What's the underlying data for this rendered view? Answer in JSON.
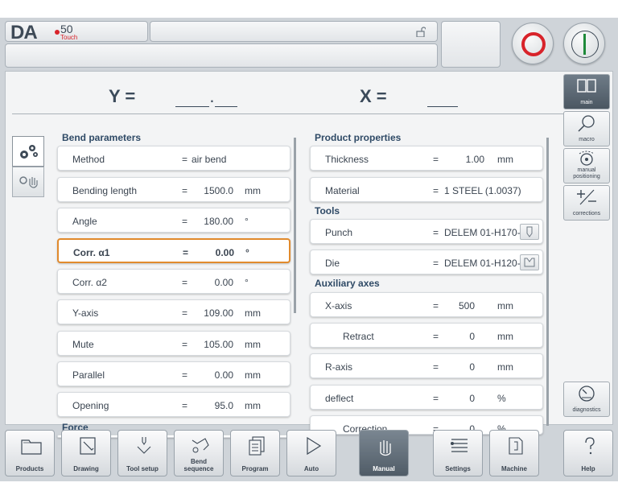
{
  "header": {
    "logo_text": "DA",
    "logo_model": "50",
    "logo_sub": "Touch"
  },
  "position": {
    "y_label": "Y =",
    "y_value": "____.___",
    "x_label": "X =",
    "x_value": "_____"
  },
  "left_panel": {
    "section1": "Bend parameters",
    "rows": [
      {
        "label": "Method",
        "eq": "=",
        "value": "air bend",
        "unit": ""
      },
      {
        "label": "Bending length",
        "eq": "=",
        "value": "1500.0",
        "unit": "mm"
      },
      {
        "label": "Angle",
        "eq": "=",
        "value": "180.00",
        "unit": "°"
      },
      {
        "label": "Corr. α1",
        "eq": "=",
        "value": "0.00",
        "unit": "°"
      },
      {
        "label": "Corr. α2",
        "eq": "=",
        "value": "0.00",
        "unit": "°"
      },
      {
        "label": "Y-axis",
        "eq": "=",
        "value": "109.00",
        "unit": "mm"
      },
      {
        "label": "Mute",
        "eq": "=",
        "value": "105.00",
        "unit": "mm"
      },
      {
        "label": "Parallel",
        "eq": "=",
        "value": "0.00",
        "unit": "mm"
      },
      {
        "label": "Opening",
        "eq": "=",
        "value": "95.0",
        "unit": "mm"
      }
    ],
    "section2": "Force"
  },
  "right_panel": {
    "section1": "Product properties",
    "thickness": {
      "label": "Thickness",
      "eq": "=",
      "value": "1.00",
      "unit": "mm"
    },
    "material": {
      "label": "Material",
      "eq": "=",
      "value": "1 STEEL (1.0037)"
    },
    "section2": "Tools",
    "punch": {
      "label": "Punch",
      "eq": "=",
      "value": "DELEM 01-H170-"
    },
    "die": {
      "label": "Die",
      "eq": "=",
      "value": "DELEM 01-H120-"
    },
    "section3": "Auxiliary axes",
    "aux": [
      {
        "label": "X-axis",
        "eq": "=",
        "value": "500",
        "unit": "mm"
      },
      {
        "label": "Retract",
        "eq": "=",
        "value": "0",
        "unit": "mm"
      },
      {
        "label": "R-axis",
        "eq": "=",
        "value": "0",
        "unit": "mm"
      },
      {
        "label": "deflect",
        "eq": "=",
        "value": "0",
        "unit": "%"
      },
      {
        "label": "Correction",
        "eq": "=",
        "value": "0",
        "unit": "%"
      }
    ]
  },
  "side_buttons": {
    "main": "main",
    "macro": "macro",
    "manual_positioning_1": "manual",
    "manual_positioning_2": "positioning",
    "corrections": "corrections",
    "diagnostics": "diagnostics"
  },
  "bottom_nav": {
    "products": "Products",
    "drawing": "Drawing",
    "tool_setup": "Tool setup",
    "bend_sequence_1": "Bend",
    "bend_sequence_2": "sequence",
    "program": "Program",
    "auto": "Auto",
    "manual": "Manual",
    "settings": "Settings",
    "machine": "Machine",
    "help": "Help"
  },
  "colors": {
    "accent_selected": "#e18a2c",
    "stop_red": "#d8232a",
    "start_green": "#1f8a3a",
    "header_text": "#2f4a66"
  }
}
